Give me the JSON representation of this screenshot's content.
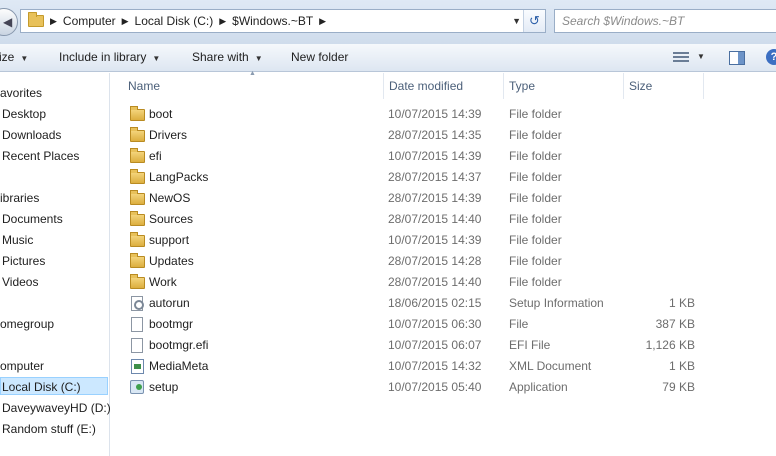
{
  "address": {
    "breadcrumbs": [
      "Computer",
      "Local Disk (C:)",
      "$Windows.~BT"
    ],
    "search_placeholder": "Search $Windows.~BT"
  },
  "toolbar": {
    "organize": "ize",
    "include": "Include in library",
    "share": "Share with",
    "new_folder": "New folder"
  },
  "nav": {
    "favorites": "avorites",
    "desktop": "Desktop",
    "downloads": "Downloads",
    "recent": "Recent Places",
    "libraries": "ibraries",
    "documents": "Documents",
    "music": "Music",
    "pictures": "Pictures",
    "videos": "Videos",
    "homegroup": "omegroup",
    "computer": "omputer",
    "local_disk": "Local Disk (C:)",
    "daveywavey": "DaveywaveyHD (D:)",
    "random": "Random stuff (E:)"
  },
  "columns": {
    "name": "Name",
    "date": "Date modified",
    "type": "Type",
    "size": "Size"
  },
  "files": [
    {
      "name": "boot",
      "date": "10/07/2015 14:39",
      "type": "File folder",
      "size": "",
      "icon": "folder-icon"
    },
    {
      "name": "Drivers",
      "date": "28/07/2015 14:35",
      "type": "File folder",
      "size": "",
      "icon": "folder-icon"
    },
    {
      "name": "efi",
      "date": "10/07/2015 14:39",
      "type": "File folder",
      "size": "",
      "icon": "folder-icon"
    },
    {
      "name": "LangPacks",
      "date": "28/07/2015 14:37",
      "type": "File folder",
      "size": "",
      "icon": "folder-icon"
    },
    {
      "name": "NewOS",
      "date": "28/07/2015 14:39",
      "type": "File folder",
      "size": "",
      "icon": "folder-icon"
    },
    {
      "name": "Sources",
      "date": "28/07/2015 14:40",
      "type": "File folder",
      "size": "",
      "icon": "folder-icon"
    },
    {
      "name": "support",
      "date": "10/07/2015 14:39",
      "type": "File folder",
      "size": "",
      "icon": "folder-icon"
    },
    {
      "name": "Updates",
      "date": "28/07/2015 14:28",
      "type": "File folder",
      "size": "",
      "icon": "folder-icon"
    },
    {
      "name": "Work",
      "date": "28/07/2015 14:40",
      "type": "File folder",
      "size": "",
      "icon": "folder-icon"
    },
    {
      "name": "autorun",
      "date": "18/06/2015 02:15",
      "type": "Setup Information",
      "size": "1 KB",
      "icon": "setup-info-icon"
    },
    {
      "name": "bootmgr",
      "date": "10/07/2015 06:30",
      "type": "File",
      "size": "387 KB",
      "icon": "file-icon"
    },
    {
      "name": "bootmgr.efi",
      "date": "10/07/2015 06:07",
      "type": "EFI File",
      "size": "1,126 KB",
      "icon": "file-icon"
    },
    {
      "name": "MediaMeta",
      "date": "10/07/2015 14:32",
      "type": "XML Document",
      "size": "1 KB",
      "icon": "xml-icon"
    },
    {
      "name": "setup",
      "date": "10/07/2015 05:40",
      "type": "Application",
      "size": "79 KB",
      "icon": "application-icon"
    }
  ]
}
